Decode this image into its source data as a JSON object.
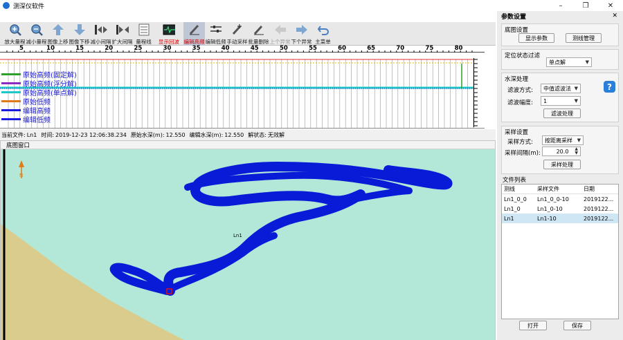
{
  "window": {
    "title": "测深仪软件",
    "minimize": "–",
    "maximize": "❐",
    "close": "✕"
  },
  "toolbar": {
    "items": [
      {
        "label": "放大量程",
        "icon": "zoom-in-icon"
      },
      {
        "label": "减小量程",
        "icon": "zoom-out-icon"
      },
      {
        "label": "图像上移",
        "icon": "arrow-up-icon"
      },
      {
        "label": "图像下移",
        "icon": "arrow-down-icon"
      },
      {
        "label": "减小间隔",
        "icon": "compress-icon"
      },
      {
        "label": "扩大间隔",
        "icon": "expand-icon"
      },
      {
        "label": "量程线",
        "icon": "range-line-icon"
      },
      {
        "label": "显示回波",
        "icon": "echo-display-icon"
      },
      {
        "label": "编辑高频",
        "icon": "edit-high-freq-icon"
      },
      {
        "label": "编辑低频",
        "icon": "edit-low-freq-icon"
      },
      {
        "label": "手动采样",
        "icon": "manual-sample-icon"
      },
      {
        "label": "批量删除",
        "icon": "batch-delete-icon"
      },
      {
        "label": "上个异常",
        "icon": "prev-anomaly-icon"
      },
      {
        "label": "下个异常",
        "icon": "next-anomaly-icon"
      },
      {
        "label": "主菜单",
        "icon": "main-menu-icon"
      }
    ]
  },
  "ruler": {
    "labels": [
      "5",
      "10",
      "15",
      "20",
      "25",
      "30",
      "35",
      "40",
      "45",
      "50",
      "55",
      "60",
      "65",
      "70",
      "75",
      "80"
    ]
  },
  "legend": {
    "items": [
      {
        "label": "原始高频(固定解)",
        "color": "#2ca02c"
      },
      {
        "label": "原始高频(浮分解)",
        "color": "#8b2bc2"
      },
      {
        "label": "原始高频(单点解)",
        "color": "#1fc8c8"
      },
      {
        "label": "原始低频",
        "color": "#e07b1a"
      },
      {
        "label": "编辑高频",
        "color": "#1a1ae0"
      },
      {
        "label": "编辑低频",
        "color": "#1a1ae0"
      }
    ]
  },
  "status": {
    "current_file_label": "当前文件:",
    "current_file": "Ln1",
    "time_label": "时间:",
    "time": "2019-12-23 12:06:38.234",
    "raw_depth_label": "原始水深(m):",
    "raw_depth": "12.550",
    "edit_depth_label": "编辑水深(m):",
    "edit_depth": "12.550",
    "solution_label": "解状态:",
    "solution": "无效解"
  },
  "map": {
    "header": "底图窗口",
    "line_label": "Ln1",
    "colors": {
      "water": "#b3e8d9",
      "land": "#d9cc8c",
      "track": "#0a1bd8",
      "marker": "#e01010"
    }
  },
  "right_panel": {
    "title": "参数设置",
    "basemap_group": "底图设置",
    "show_params_button": "显示参数",
    "survey_mgmt_button": "测线管理",
    "positioning_group": "定位状态过滤",
    "positioning_value": "单点解",
    "depth_group": "水深处理",
    "filter_method_label": "滤波方式:",
    "filter_method_value": "中值滤波法",
    "filter_width_label": "滤波幅度:",
    "filter_width_value": "1",
    "filter_process_button": "滤波处理",
    "sampling_group": "采样设置",
    "sampling_method_label": "采样方式:",
    "sampling_method_value": "按距离采样",
    "sampling_interval_label": "采样间隔(m):",
    "sampling_interval_value": "20.0",
    "sampling_process_button": "采样处理",
    "file_list_title": "文件列表",
    "file_list_headers": [
      "测线",
      "采样文件",
      "日期"
    ],
    "file_rows": [
      {
        "line": "Ln1_0_0",
        "sample": "Ln1_0_0-10",
        "date": "2019122..."
      },
      {
        "line": "Ln1_0",
        "sample": "Ln1_0-10",
        "date": "2019122..."
      },
      {
        "line": "Ln1",
        "sample": "Ln1-10",
        "date": "2019122..."
      }
    ],
    "open_button": "打开",
    "save_button": "保存"
  }
}
